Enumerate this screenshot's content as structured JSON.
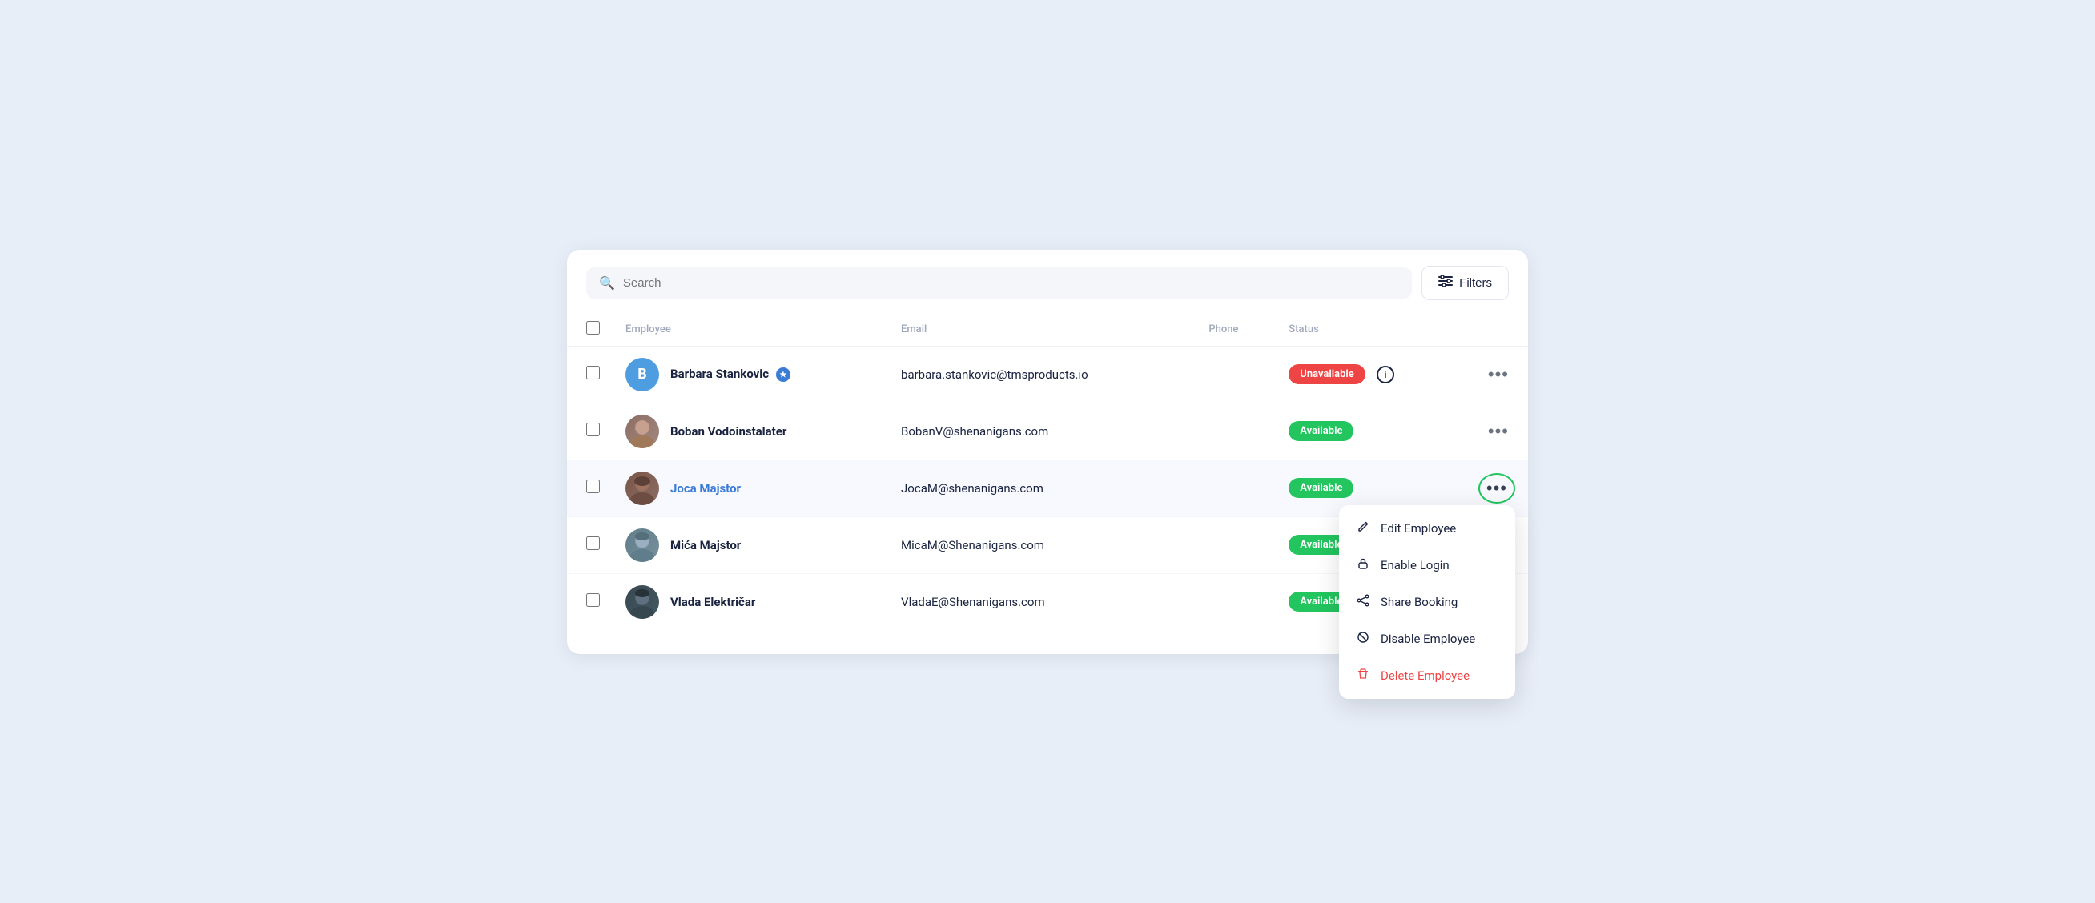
{
  "toolbar": {
    "search_placeholder": "Search",
    "filters_label": "Filters"
  },
  "table": {
    "headers": {
      "employee": "Employee",
      "email": "Email",
      "phone": "Phone",
      "status": "Status"
    },
    "rows": [
      {
        "id": 1,
        "name": "Barbara Stankovic",
        "verified": true,
        "email": "barbara.stankovic@tmsproducts.io",
        "phone": "",
        "status": "Unavailable",
        "status_type": "unavailable",
        "avatar_type": "initial",
        "avatar_initial": "B",
        "avatar_class": "avatar-b",
        "show_info": true,
        "active_menu": false
      },
      {
        "id": 2,
        "name": "Boban Vodoinstalater",
        "verified": false,
        "email": "BobanV@shenanigans.com",
        "phone": "",
        "status": "Available",
        "status_type": "available",
        "avatar_type": "photo",
        "avatar_class": "face-boban",
        "show_info": false,
        "active_menu": false
      },
      {
        "id": 3,
        "name": "Joca Majstor",
        "verified": false,
        "email": "JocaM@shenanigans.com",
        "phone": "",
        "status": "Available",
        "status_type": "available",
        "avatar_type": "photo",
        "avatar_class": "face-joca",
        "show_info": false,
        "active_menu": true
      },
      {
        "id": 4,
        "name": "Mića Majstor",
        "verified": false,
        "email": "MicaM@Shenanigans.com",
        "phone": "",
        "status": "Available",
        "status_type": "available",
        "avatar_type": "photo",
        "avatar_class": "face-mica",
        "show_info": false,
        "active_menu": false
      },
      {
        "id": 5,
        "name": "Vlada Električar",
        "verified": false,
        "email": "VladaE@Shenanigans.com",
        "phone": "",
        "status": "Available",
        "status_type": "available",
        "avatar_type": "photo",
        "avatar_class": "face-vlada",
        "show_info": false,
        "active_menu": false
      }
    ]
  },
  "dropdown_menu": {
    "edit_label": "Edit Employee",
    "enable_login_label": "Enable Login",
    "share_booking_label": "Share Booking",
    "disable_label": "Disable Employee",
    "delete_label": "Delete Employee"
  }
}
